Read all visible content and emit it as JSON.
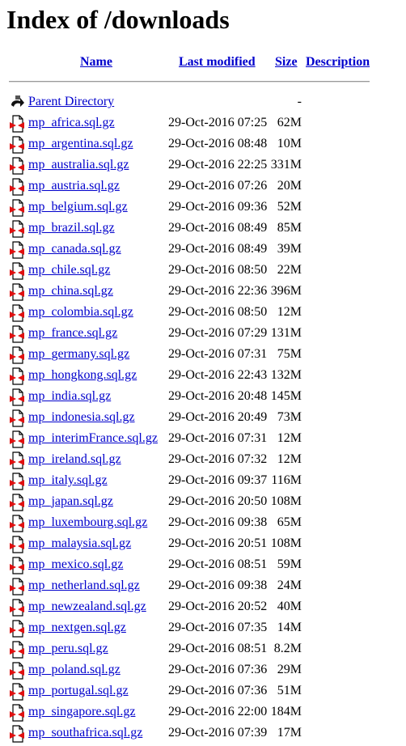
{
  "title": "Index of /downloads",
  "columns": {
    "name": "Name",
    "last_modified": "Last modified",
    "size": "Size",
    "description": "Description"
  },
  "parent": {
    "label": "Parent Directory",
    "size": "-",
    "icon": "back-arrow-icon"
  },
  "files": [
    {
      "name": "mp_africa.sql.gz",
      "date": "29-Oct-2016 07:25",
      "size": "62M"
    },
    {
      "name": "mp_argentina.sql.gz",
      "date": "29-Oct-2016 08:48",
      "size": "10M"
    },
    {
      "name": "mp_australia.sql.gz",
      "date": "29-Oct-2016 22:25",
      "size": "331M"
    },
    {
      "name": "mp_austria.sql.gz",
      "date": "29-Oct-2016 07:26",
      "size": "20M"
    },
    {
      "name": "mp_belgium.sql.gz",
      "date": "29-Oct-2016 09:36",
      "size": "52M"
    },
    {
      "name": "mp_brazil.sql.gz",
      "date": "29-Oct-2016 08:49",
      "size": "85M"
    },
    {
      "name": "mp_canada.sql.gz",
      "date": "29-Oct-2016 08:49",
      "size": "39M"
    },
    {
      "name": "mp_chile.sql.gz",
      "date": "29-Oct-2016 08:50",
      "size": "22M"
    },
    {
      "name": "mp_china.sql.gz",
      "date": "29-Oct-2016 22:36",
      "size": "396M"
    },
    {
      "name": "mp_colombia.sql.gz",
      "date": "29-Oct-2016 08:50",
      "size": "12M"
    },
    {
      "name": "mp_france.sql.gz",
      "date": "29-Oct-2016 07:29",
      "size": "131M"
    },
    {
      "name": "mp_germany.sql.gz",
      "date": "29-Oct-2016 07:31",
      "size": "75M"
    },
    {
      "name": "mp_hongkong.sql.gz",
      "date": "29-Oct-2016 22:43",
      "size": "132M"
    },
    {
      "name": "mp_india.sql.gz",
      "date": "29-Oct-2016 20:48",
      "size": "145M"
    },
    {
      "name": "mp_indonesia.sql.gz",
      "date": "29-Oct-2016 20:49",
      "size": "73M"
    },
    {
      "name": "mp_interimFrance.sql.gz",
      "date": "29-Oct-2016 07:31",
      "size": "12M"
    },
    {
      "name": "mp_ireland.sql.gz",
      "date": "29-Oct-2016 07:32",
      "size": "12M"
    },
    {
      "name": "mp_italy.sql.gz",
      "date": "29-Oct-2016 09:37",
      "size": "116M"
    },
    {
      "name": "mp_japan.sql.gz",
      "date": "29-Oct-2016 20:50",
      "size": "108M"
    },
    {
      "name": "mp_luxembourg.sql.gz",
      "date": "29-Oct-2016 09:38",
      "size": "65M"
    },
    {
      "name": "mp_malaysia.sql.gz",
      "date": "29-Oct-2016 20:51",
      "size": "108M"
    },
    {
      "name": "mp_mexico.sql.gz",
      "date": "29-Oct-2016 08:51",
      "size": "59M"
    },
    {
      "name": "mp_netherland.sql.gz",
      "date": "29-Oct-2016 09:38",
      "size": "24M"
    },
    {
      "name": "mp_newzealand.sql.gz",
      "date": "29-Oct-2016 20:52",
      "size": "40M"
    },
    {
      "name": "mp_nextgen.sql.gz",
      "date": "29-Oct-2016 07:35",
      "size": "14M"
    },
    {
      "name": "mp_peru.sql.gz",
      "date": "29-Oct-2016 08:51",
      "size": "8.2M"
    },
    {
      "name": "mp_poland.sql.gz",
      "date": "29-Oct-2016 07:36",
      "size": "29M"
    },
    {
      "name": "mp_portugal.sql.gz",
      "date": "29-Oct-2016 07:36",
      "size": "51M"
    },
    {
      "name": "mp_singapore.sql.gz",
      "date": "29-Oct-2016 22:00",
      "size": "184M"
    },
    {
      "name": "mp_southafrica.sql.gz",
      "date": "29-Oct-2016 07:39",
      "size": "17M"
    }
  ],
  "file_icon": "compressed-file-icon"
}
